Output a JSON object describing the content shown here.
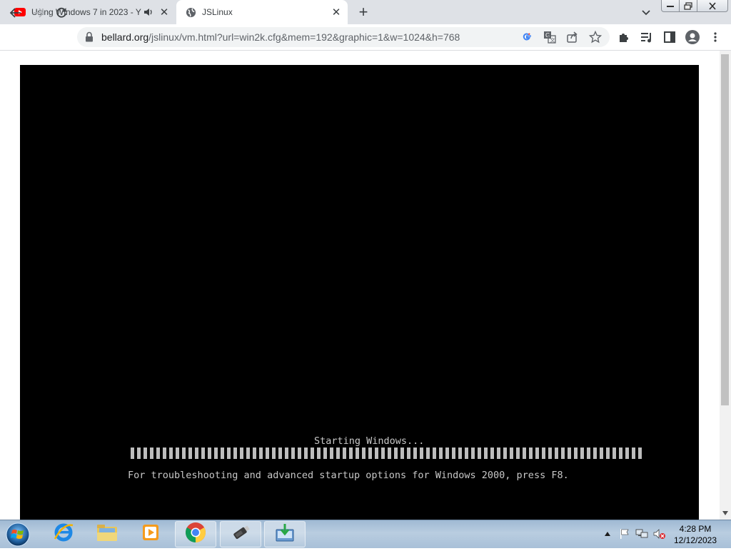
{
  "browser": {
    "tabs": [
      {
        "title": "Using Windows 7 in 2023 - Y",
        "favicon": "youtube-icon",
        "audio": true,
        "active": false
      },
      {
        "title": "JSLinux",
        "favicon": "globe-icon",
        "audio": false,
        "active": true
      }
    ],
    "url_host": "bellard.org",
    "url_rest": "/jslinux/vm.html?url=win2k.cfg&mem=192&graphic=1&w=1024&h=768"
  },
  "vm_screen": {
    "status_text": "Starting Windows...",
    "hint_text": "For troubleshooting and advanced startup options for Windows 2000, press F8.",
    "progress": 1.0
  },
  "taskbar": {
    "apps": [
      "internet-explorer-icon",
      "windows-explorer-icon",
      "media-player-icon",
      "chrome-icon",
      "usb-drive-icon",
      "installer-icon"
    ],
    "clock_time": "4:28 PM",
    "clock_date": "12/12/2023"
  },
  "colors": {
    "tabstrip": "#dee1e6",
    "vm_bg": "#000000",
    "vm_text": "#c8c8c8",
    "taskbar": "#a8c0d8"
  }
}
